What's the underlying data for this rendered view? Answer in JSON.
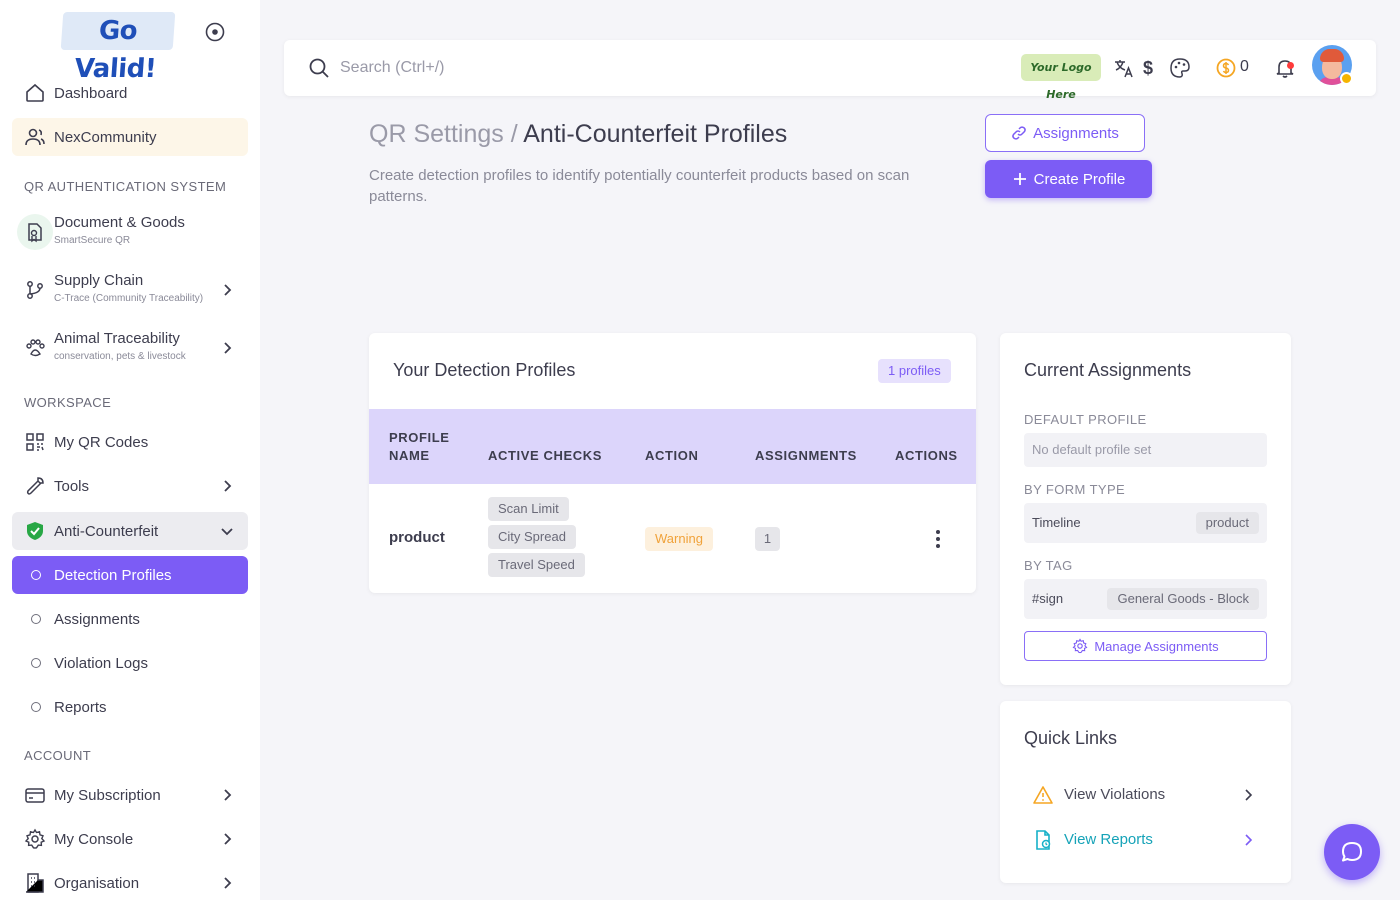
{
  "brand": {
    "logo_text": "Go Valid!",
    "accent": "#7c5cf5"
  },
  "sidebar": {
    "dashboard": "Dashboard",
    "community": "NexCommunity",
    "sections": {
      "qr_auth": "QR AUTHENTICATION SYSTEM",
      "workspace": "WORKSPACE",
      "account": "ACCOUNT"
    },
    "doc_goods": {
      "label": "Document & Goods",
      "sub": "SmartSecure QR"
    },
    "supply_chain": {
      "label": "Supply Chain",
      "sub": "C-Trace (Community Traceability)"
    },
    "animal": {
      "label": "Animal Traceability",
      "sub": "conservation, pets & livestock"
    },
    "my_qr": "My QR Codes",
    "tools": "Tools",
    "anti_counterfeit": "Anti-Counterfeit",
    "detection_profiles": "Detection Profiles",
    "assignments": "Assignments",
    "violation_logs": "Violation Logs",
    "reports": "Reports",
    "subscription": "My Subscription",
    "console": "My Console",
    "organisation": "Organisation"
  },
  "topbar": {
    "search_placeholder": "Search (Ctrl+/)",
    "your_logo": "Your Logo Here",
    "currency": "$",
    "coin_count": "0"
  },
  "header": {
    "crumb_parent": "QR Settings /",
    "crumb_current": "Anti-Counterfeit Profiles",
    "description": "Create detection profiles to identify potentially counterfeit products based on scan patterns.",
    "assignments_btn": "Assignments",
    "create_btn": "Create Profile"
  },
  "profiles": {
    "title": "Your Detection Profiles",
    "count": "1 profiles",
    "columns": {
      "name_line1": "PROFILE",
      "name_line2": "NAME",
      "checks": "ACTIVE CHECKS",
      "action": "ACTION",
      "assignments": "ASSIGNMENTS",
      "actions": "ACTIONS"
    },
    "row": {
      "name": "product",
      "checks": [
        "Scan Limit",
        "City Spread",
        "Travel Speed"
      ],
      "action": "Warning",
      "assignments": "1"
    }
  },
  "assignments_card": {
    "title": "Current Assignments",
    "default_label": "DEFAULT PROFILE",
    "default_value": "No default profile set",
    "form_type_label": "BY FORM TYPE",
    "form_type_name": "Timeline",
    "form_type_profile": "product",
    "tag_label": "BY TAG",
    "tag_name": "#sign",
    "tag_profile": "General Goods - Block",
    "manage_btn": "Manage Assignments"
  },
  "quick_links": {
    "title": "Quick Links",
    "violations": "View Violations",
    "reports": "View Reports"
  }
}
